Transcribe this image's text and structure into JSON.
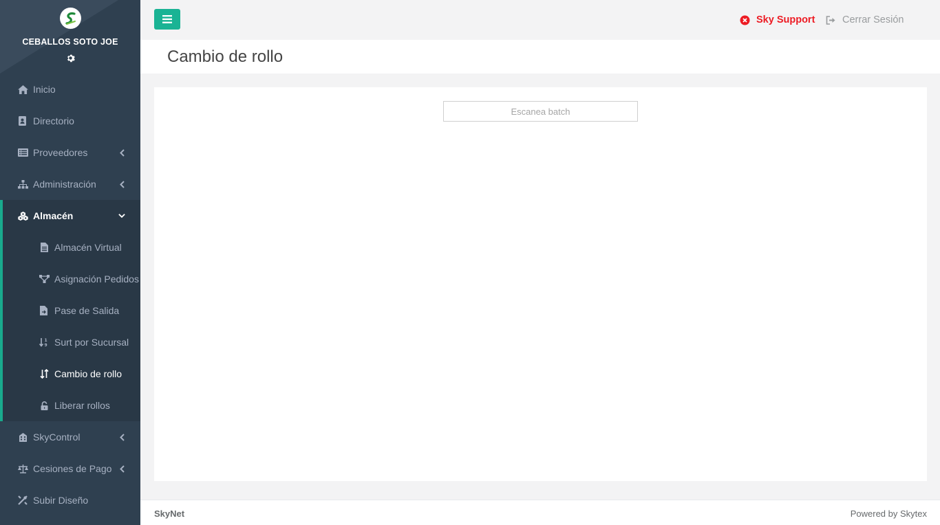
{
  "colors": {
    "sidebar_bg": "#2f4050",
    "accent": "#1ab394",
    "support_red": "#ed1c24"
  },
  "profile": {
    "name": "CEBALLOS SOTO JOE",
    "logo_icon": "skytex-logo",
    "settings_icon": "gear-icon"
  },
  "nav": {
    "inicio": "Inicio",
    "directorio": "Directorio",
    "proveedores": "Proveedores",
    "administracion": "Administración",
    "almacen": "Almacén",
    "skycontrol": "SkyControl",
    "cesiones": "Cesiones de Pago",
    "subir_diseno": "Subir Diseño"
  },
  "submenu": {
    "almacen_virtual": "Almacén Virtual",
    "asignacion_pedidos": "Asignación Pedidos",
    "pase_salida": "Pase de Salida",
    "surt_sucursal": "Surt por Sucursal",
    "cambio_rollo": "Cambio de rollo",
    "liberar_rollos": "Liberar rollos"
  },
  "topbar": {
    "support": "Sky Support",
    "logout": "Cerrar Sesión"
  },
  "page": {
    "title": "Cambio de rollo",
    "batch_placeholder": "Escanea batch",
    "batch_value": ""
  },
  "footer": {
    "left": "SkyNet",
    "right": "Powered by Skytex"
  }
}
